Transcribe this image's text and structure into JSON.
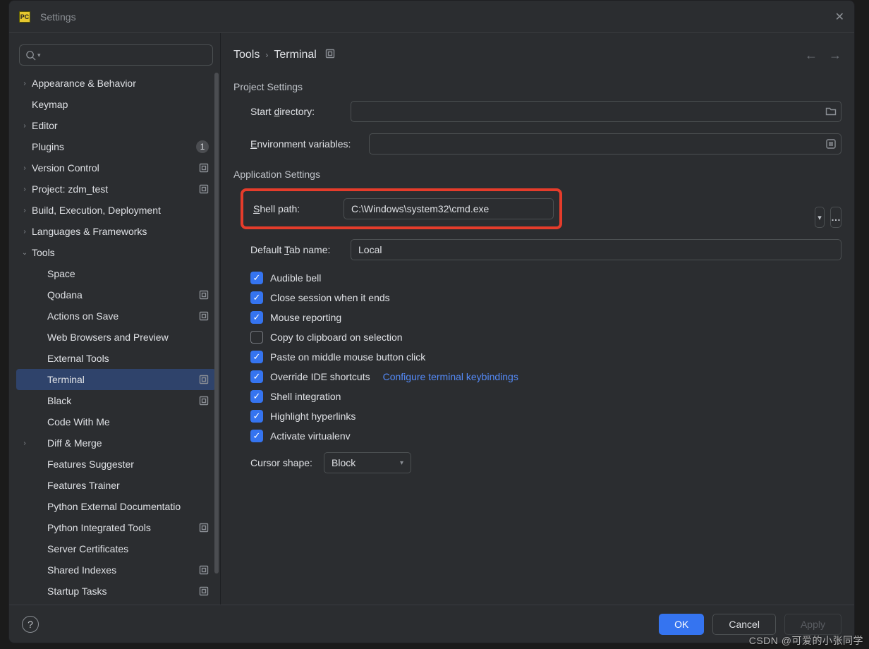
{
  "window": {
    "title": "Settings"
  },
  "sidebar": {
    "search_placeholder": "",
    "items": [
      {
        "label": "Appearance & Behavior",
        "depth": 0,
        "chev": "right"
      },
      {
        "label": "Keymap",
        "depth": 0
      },
      {
        "label": "Editor",
        "depth": 0,
        "chev": "right"
      },
      {
        "label": "Plugins",
        "depth": 0,
        "badge": "1"
      },
      {
        "label": "Version Control",
        "depth": 0,
        "chev": "right",
        "pin": true
      },
      {
        "label": "Project: zdm_test",
        "depth": 0,
        "chev": "right",
        "pin": true
      },
      {
        "label": "Build, Execution, Deployment",
        "depth": 0,
        "chev": "right"
      },
      {
        "label": "Languages & Frameworks",
        "depth": 0,
        "chev": "right"
      },
      {
        "label": "Tools",
        "depth": 0,
        "chev": "down"
      },
      {
        "label": "Space",
        "depth": 1
      },
      {
        "label": "Qodana",
        "depth": 1,
        "pin": true
      },
      {
        "label": "Actions on Save",
        "depth": 1,
        "pin": true
      },
      {
        "label": "Web Browsers and Preview",
        "depth": 1
      },
      {
        "label": "External Tools",
        "depth": 1
      },
      {
        "label": "Terminal",
        "depth": 1,
        "pin": true,
        "selected": true
      },
      {
        "label": "Black",
        "depth": 1,
        "pin": true
      },
      {
        "label": "Code With Me",
        "depth": 1
      },
      {
        "label": "Diff & Merge",
        "depth": 1,
        "chev": "right"
      },
      {
        "label": "Features Suggester",
        "depth": 1
      },
      {
        "label": "Features Trainer",
        "depth": 1
      },
      {
        "label": "Python External Documentatio",
        "depth": 1
      },
      {
        "label": "Python Integrated Tools",
        "depth": 1,
        "pin": true
      },
      {
        "label": "Server Certificates",
        "depth": 1
      },
      {
        "label": "Shared Indexes",
        "depth": 1,
        "pin": true
      },
      {
        "label": "Startup Tasks",
        "depth": 1,
        "pin": true
      }
    ]
  },
  "breadcrumb": {
    "root": "Tools",
    "leaf": "Terminal"
  },
  "project_settings": {
    "heading": "Project Settings",
    "start_dir_pre": "Start ",
    "start_dir_u": "d",
    "start_dir_post": "irectory:",
    "start_dir_value": "",
    "env_pre": "",
    "env_u": "E",
    "env_post": "nvironment variables:",
    "env_value": ""
  },
  "app_settings": {
    "heading": "Application Settings",
    "shell_pre": "",
    "shell_u": "S",
    "shell_post": "hell path:",
    "shell_value": "C:\\Windows\\system32\\cmd.exe",
    "tab_pre": "Default ",
    "tab_u": "T",
    "tab_post": "ab name:",
    "tab_value": "Local",
    "checks": [
      {
        "checked": true,
        "label": "Audible bell"
      },
      {
        "checked": true,
        "label": "Close session when it ends"
      },
      {
        "checked": true,
        "label": "Mouse reporting"
      },
      {
        "checked": false,
        "label": "Copy to clipboard on selection"
      },
      {
        "checked": true,
        "label": "Paste on middle mouse button click"
      },
      {
        "checked": true,
        "label": "Override IDE shortcuts",
        "link": "Configure terminal keybindings"
      },
      {
        "checked": true,
        "label": "Shell integration"
      },
      {
        "checked": true,
        "label": "Highlight hyperlinks"
      },
      {
        "checked": true,
        "label": "Activate virtualenv"
      }
    ],
    "cursor_label": "Cursor shape:",
    "cursor_value": "Block"
  },
  "footer": {
    "ok": "OK",
    "cancel": "Cancel",
    "apply": "Apply"
  },
  "watermark": "CSDN @可爱的小张同学"
}
